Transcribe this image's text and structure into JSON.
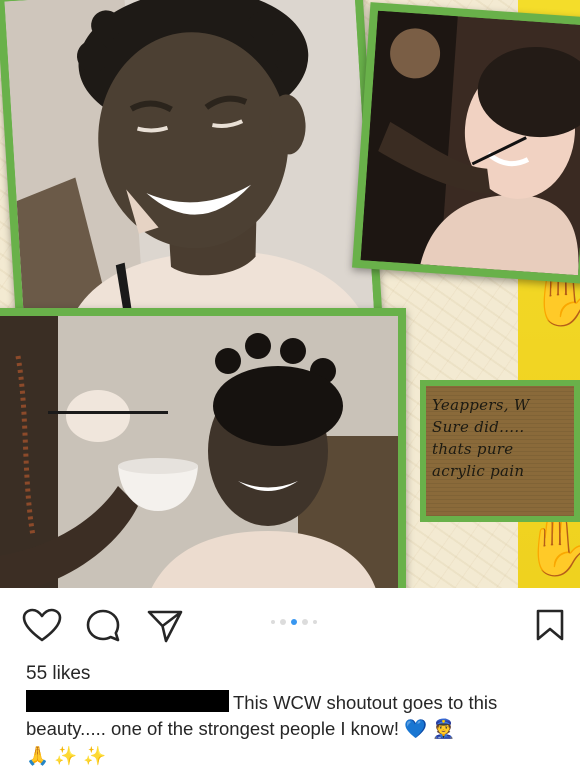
{
  "post": {
    "likes": "55 likes",
    "caption": {
      "text": "This WCW shoutout goes to this beauty..... one of the strongest people I know!",
      "emoji_heart": "💙",
      "emoji_officer": "👮",
      "emoji_hands": "🙏",
      "emoji_sparkles": "✨ ✨"
    },
    "carousel": {
      "count": 5,
      "active": 2
    }
  },
  "photo": {
    "sign_lines": [
      "Yeappers, W",
      "Sure  did.....",
      "thats  pure",
      "acrylic  pain"
    ]
  },
  "icons": {
    "like": "heart-outline-icon",
    "comment": "comment-bubble-icon",
    "share": "paper-plane-icon",
    "save": "bookmark-icon"
  },
  "colors": {
    "frame_green": "#69b14a",
    "strip_yellow": "#f4dd2a",
    "carousel_active": "#3897f0",
    "emoji_heart": "#3897f0"
  }
}
